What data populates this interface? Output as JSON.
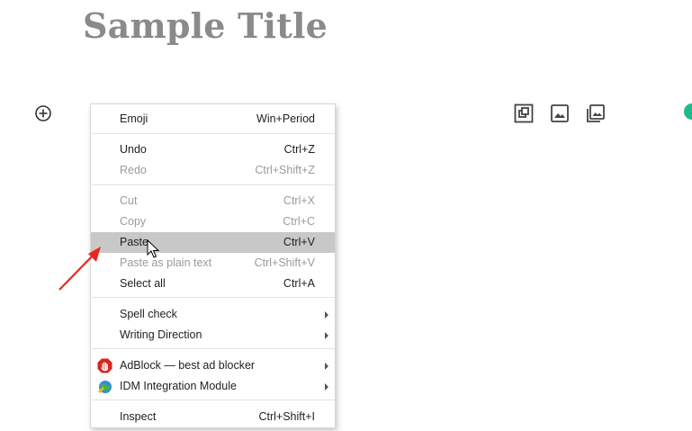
{
  "page": {
    "title": "Sample Title"
  },
  "toolbar": {
    "icons": [
      "add-block-icon",
      "embed-icon",
      "image-icon",
      "gallery-icon"
    ]
  },
  "context_menu": {
    "emoji": {
      "label": "Emoji",
      "shortcut": "Win+Period"
    },
    "undo": {
      "label": "Undo",
      "shortcut": "Ctrl+Z"
    },
    "redo": {
      "label": "Redo",
      "shortcut": "Ctrl+Shift+Z"
    },
    "cut": {
      "label": "Cut",
      "shortcut": "Ctrl+X"
    },
    "copy": {
      "label": "Copy",
      "shortcut": "Ctrl+C"
    },
    "paste": {
      "label": "Paste",
      "shortcut": "Ctrl+V"
    },
    "paste_plain": {
      "label": "Paste as plain text",
      "shortcut": "Ctrl+Shift+V"
    },
    "select_all": {
      "label": "Select all",
      "shortcut": "Ctrl+A"
    },
    "spell_check": {
      "label": "Spell check"
    },
    "writing_direction": {
      "label": "Writing Direction"
    },
    "adblock": {
      "label": "AdBlock — best ad blocker"
    },
    "idm": {
      "label": "IDM Integration Module"
    },
    "inspect": {
      "label": "Inspect",
      "shortcut": "Ctrl+Shift+I"
    }
  },
  "colors": {
    "title": "#8a8a8a",
    "highlight": "#c8c8c8",
    "annotation_arrow": "#e8281e",
    "accent_green": "#20b98a"
  }
}
